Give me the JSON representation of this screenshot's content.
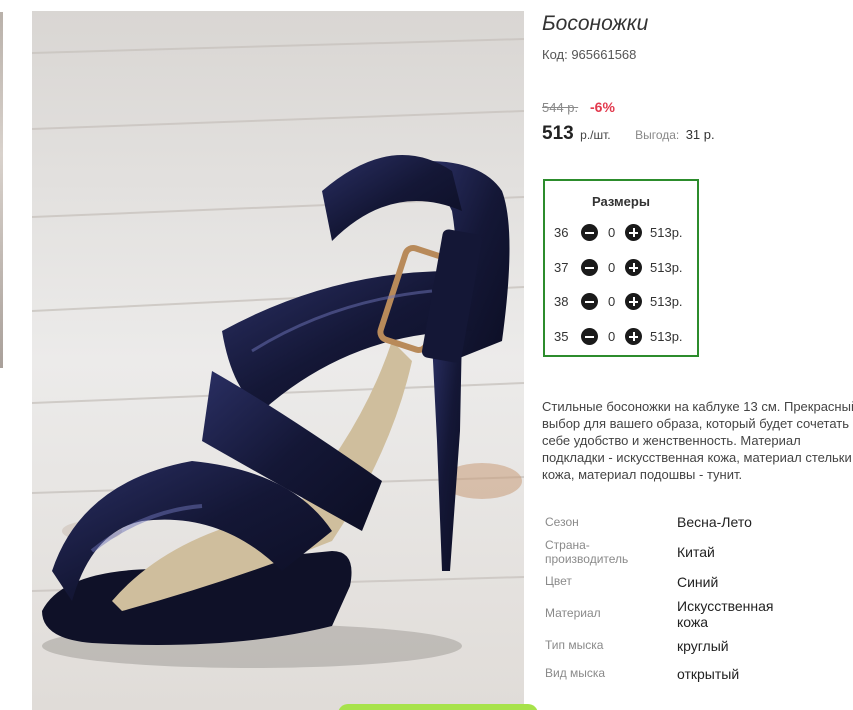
{
  "product": {
    "title": "Босоножки",
    "code": "Код: 965661568",
    "old_price": "544 р.",
    "discount": "-6%",
    "price": "513",
    "price_unit": "р./шт.",
    "benefit_label": "Выгода:",
    "benefit_value": "31 р."
  },
  "sizes": {
    "title": "Размеры",
    "rows": [
      {
        "size": "36",
        "qty": "0",
        "price": "513р."
      },
      {
        "size": "37",
        "qty": "0",
        "price": "513р."
      },
      {
        "size": "38",
        "qty": "0",
        "price": "513р."
      },
      {
        "size": "35",
        "qty": "0",
        "price": "513р."
      }
    ]
  },
  "description": "Стильные босоножки на каблуке 13 см. Прекрасный выбор для вашего образа, который будет сочетать в себе удобство и женственность. Материал подкладки - искусственная кожа, материал стельки - кожа, материал подошвы - тунит.",
  "properties": [
    {
      "key": "Сезон",
      "value": "Весна-Лето"
    },
    {
      "key": "Страна-производитель",
      "value": "Китай"
    },
    {
      "key": "Цвет",
      "value": "Синий"
    },
    {
      "key": "Материал",
      "value": "Искусственная кожа"
    },
    {
      "key": "Тип мыска",
      "value": "круглый"
    },
    {
      "key": "Вид мыска",
      "value": "открытый"
    }
  ],
  "image": {
    "alt_icon": "navy-patent-sandal-photo",
    "colors": {
      "shoe": "#1c1f46",
      "wood": "#e4e1de",
      "buckle": "#b88a5a",
      "accent_green": "#2c8c2c",
      "discount_red": "#e2394d"
    }
  }
}
